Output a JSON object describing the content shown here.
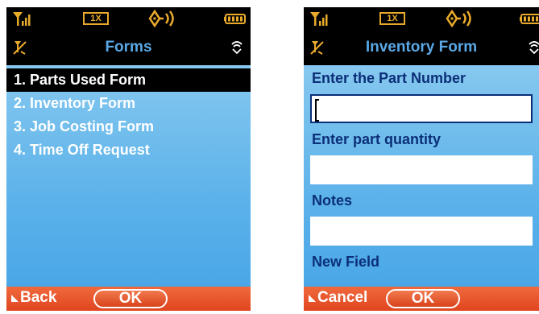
{
  "status_bar": {
    "network": "1X"
  },
  "screens": [
    {
      "title": "Forms",
      "menu_items": [
        "1. Parts Used Form",
        "2. Inventory Form",
        "3. Job Costing Form",
        "4. Time Off Request"
      ],
      "selected_index": 0,
      "soft_left": "Back",
      "soft_center": "OK"
    },
    {
      "title": "Inventory Form",
      "fields": [
        {
          "label": "Enter the Part Number",
          "value": ""
        },
        {
          "label": "Enter part quantity",
          "value": ""
        },
        {
          "label": "Notes",
          "value": ""
        },
        {
          "label": "New Field"
        }
      ],
      "soft_left": "Cancel",
      "soft_center": "OK"
    }
  ],
  "colors": {
    "title_text": "#5aa8e6",
    "status_icons": "#e9aa2c",
    "body_gradient_top": "#86c8ef",
    "body_gradient_bottom": "#4aa7e7",
    "form_label": "#0b2f78",
    "softkey_bar": "#e0451f"
  }
}
